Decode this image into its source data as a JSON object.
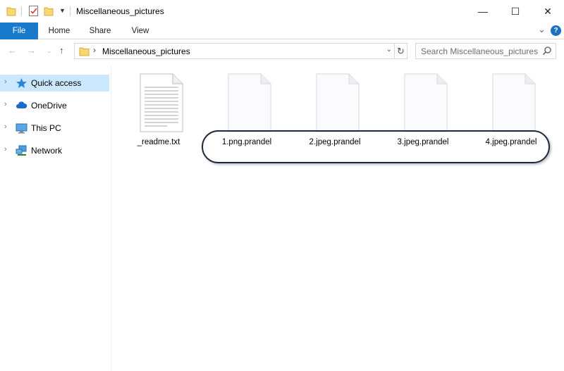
{
  "window": {
    "title": "Miscellaneous_pictures",
    "minimize_glyph": "—",
    "maximize_glyph": "☐",
    "close_glyph": "✕"
  },
  "ribbon": {
    "tabs": [
      "File",
      "Home",
      "Share",
      "View"
    ],
    "expand_glyph": "⌄",
    "help_glyph": "?"
  },
  "address": {
    "path": "Miscellaneous_pictures",
    "search_placeholder": "Search Miscellaneous_pictures"
  },
  "nav": {
    "items": [
      {
        "label": "Quick access",
        "icon": "star-icon",
        "selected": true
      },
      {
        "label": "OneDrive",
        "icon": "cloud-icon",
        "selected": false
      },
      {
        "label": "This PC",
        "icon": "computer-icon",
        "selected": false
      },
      {
        "label": "Network",
        "icon": "network-icon",
        "selected": false
      }
    ]
  },
  "files": [
    {
      "name": "_readme.txt",
      "type": "text-document-icon"
    },
    {
      "name": "1.png.prandel",
      "type": "blank-file-icon"
    },
    {
      "name": "2.jpeg.prandel",
      "type": "blank-file-icon"
    },
    {
      "name": "3.jpeg.prandel",
      "type": "blank-file-icon"
    },
    {
      "name": "4.jpeg.prandel",
      "type": "blank-file-icon"
    }
  ],
  "colors": {
    "accent": "#1979ca",
    "selection": "#cce8ff",
    "highlight_ring": "#1b2b3c"
  }
}
